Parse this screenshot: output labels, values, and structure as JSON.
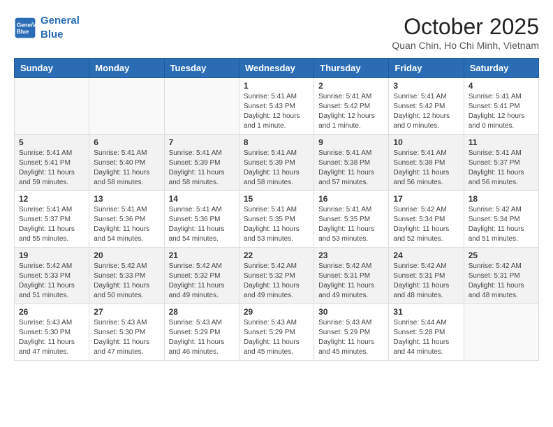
{
  "header": {
    "logo_line1": "General",
    "logo_line2": "Blue",
    "title": "October 2025",
    "subtitle": "Quan Chin, Ho Chi Minh, Vietnam"
  },
  "columns": [
    "Sunday",
    "Monday",
    "Tuesday",
    "Wednesday",
    "Thursday",
    "Friday",
    "Saturday"
  ],
  "weeks": [
    {
      "days": [
        {
          "num": "",
          "info": ""
        },
        {
          "num": "",
          "info": ""
        },
        {
          "num": "",
          "info": ""
        },
        {
          "num": "1",
          "info": "Sunrise: 5:41 AM\nSunset: 5:43 PM\nDaylight: 12 hours\nand 1 minute."
        },
        {
          "num": "2",
          "info": "Sunrise: 5:41 AM\nSunset: 5:42 PM\nDaylight: 12 hours\nand 1 minute."
        },
        {
          "num": "3",
          "info": "Sunrise: 5:41 AM\nSunset: 5:42 PM\nDaylight: 12 hours\nand 0 minutes."
        },
        {
          "num": "4",
          "info": "Sunrise: 5:41 AM\nSunset: 5:41 PM\nDaylight: 12 hours\nand 0 minutes."
        }
      ]
    },
    {
      "days": [
        {
          "num": "5",
          "info": "Sunrise: 5:41 AM\nSunset: 5:41 PM\nDaylight: 11 hours\nand 59 minutes."
        },
        {
          "num": "6",
          "info": "Sunrise: 5:41 AM\nSunset: 5:40 PM\nDaylight: 11 hours\nand 58 minutes."
        },
        {
          "num": "7",
          "info": "Sunrise: 5:41 AM\nSunset: 5:39 PM\nDaylight: 11 hours\nand 58 minutes."
        },
        {
          "num": "8",
          "info": "Sunrise: 5:41 AM\nSunset: 5:39 PM\nDaylight: 11 hours\nand 58 minutes."
        },
        {
          "num": "9",
          "info": "Sunrise: 5:41 AM\nSunset: 5:38 PM\nDaylight: 11 hours\nand 57 minutes."
        },
        {
          "num": "10",
          "info": "Sunrise: 5:41 AM\nSunset: 5:38 PM\nDaylight: 11 hours\nand 56 minutes."
        },
        {
          "num": "11",
          "info": "Sunrise: 5:41 AM\nSunset: 5:37 PM\nDaylight: 11 hours\nand 56 minutes."
        }
      ]
    },
    {
      "days": [
        {
          "num": "12",
          "info": "Sunrise: 5:41 AM\nSunset: 5:37 PM\nDaylight: 11 hours\nand 55 minutes."
        },
        {
          "num": "13",
          "info": "Sunrise: 5:41 AM\nSunset: 5:36 PM\nDaylight: 11 hours\nand 54 minutes."
        },
        {
          "num": "14",
          "info": "Sunrise: 5:41 AM\nSunset: 5:36 PM\nDaylight: 11 hours\nand 54 minutes."
        },
        {
          "num": "15",
          "info": "Sunrise: 5:41 AM\nSunset: 5:35 PM\nDaylight: 11 hours\nand 53 minutes."
        },
        {
          "num": "16",
          "info": "Sunrise: 5:41 AM\nSunset: 5:35 PM\nDaylight: 11 hours\nand 53 minutes."
        },
        {
          "num": "17",
          "info": "Sunrise: 5:42 AM\nSunset: 5:34 PM\nDaylight: 11 hours\nand 52 minutes."
        },
        {
          "num": "18",
          "info": "Sunrise: 5:42 AM\nSunset: 5:34 PM\nDaylight: 11 hours\nand 51 minutes."
        }
      ]
    },
    {
      "days": [
        {
          "num": "19",
          "info": "Sunrise: 5:42 AM\nSunset: 5:33 PM\nDaylight: 11 hours\nand 51 minutes."
        },
        {
          "num": "20",
          "info": "Sunrise: 5:42 AM\nSunset: 5:33 PM\nDaylight: 11 hours\nand 50 minutes."
        },
        {
          "num": "21",
          "info": "Sunrise: 5:42 AM\nSunset: 5:32 PM\nDaylight: 11 hours\nand 49 minutes."
        },
        {
          "num": "22",
          "info": "Sunrise: 5:42 AM\nSunset: 5:32 PM\nDaylight: 11 hours\nand 49 minutes."
        },
        {
          "num": "23",
          "info": "Sunrise: 5:42 AM\nSunset: 5:31 PM\nDaylight: 11 hours\nand 49 minutes."
        },
        {
          "num": "24",
          "info": "Sunrise: 5:42 AM\nSunset: 5:31 PM\nDaylight: 11 hours\nand 48 minutes."
        },
        {
          "num": "25",
          "info": "Sunrise: 5:42 AM\nSunset: 5:31 PM\nDaylight: 11 hours\nand 48 minutes."
        }
      ]
    },
    {
      "days": [
        {
          "num": "26",
          "info": "Sunrise: 5:43 AM\nSunset: 5:30 PM\nDaylight: 11 hours\nand 47 minutes."
        },
        {
          "num": "27",
          "info": "Sunrise: 5:43 AM\nSunset: 5:30 PM\nDaylight: 11 hours\nand 47 minutes."
        },
        {
          "num": "28",
          "info": "Sunrise: 5:43 AM\nSunset: 5:29 PM\nDaylight: 11 hours\nand 46 minutes."
        },
        {
          "num": "29",
          "info": "Sunrise: 5:43 AM\nSunset: 5:29 PM\nDaylight: 11 hours\nand 45 minutes."
        },
        {
          "num": "30",
          "info": "Sunrise: 5:43 AM\nSunset: 5:29 PM\nDaylight: 11 hours\nand 45 minutes."
        },
        {
          "num": "31",
          "info": "Sunrise: 5:44 AM\nSunset: 5:28 PM\nDaylight: 11 hours\nand 44 minutes."
        },
        {
          "num": "",
          "info": ""
        }
      ]
    }
  ]
}
